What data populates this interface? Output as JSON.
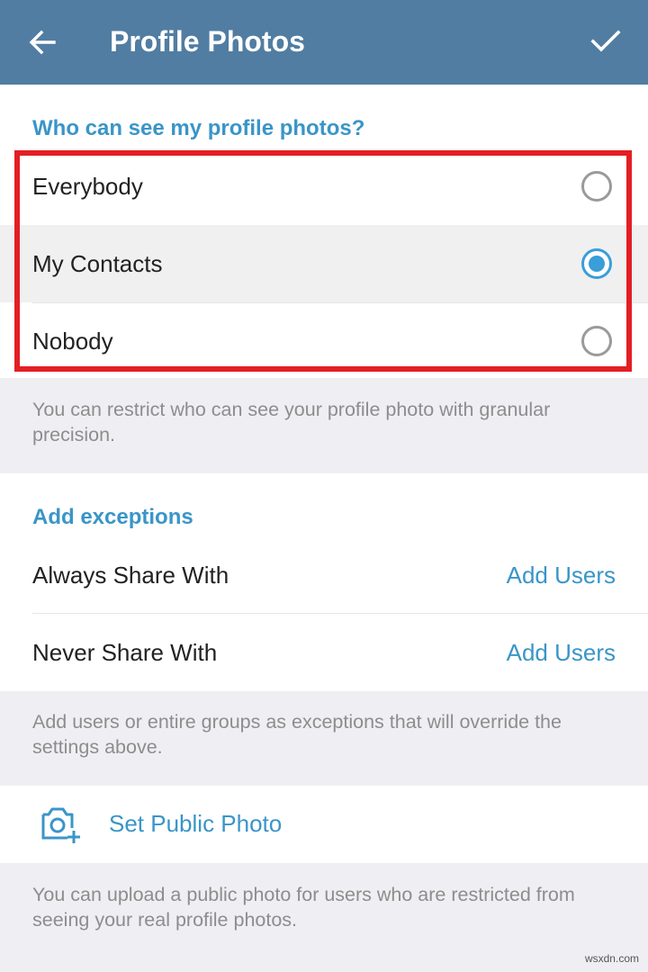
{
  "appbar": {
    "title": "Profile Photos",
    "back_icon": "arrow-left-icon",
    "confirm_icon": "checkmark-icon",
    "color": "#517da2"
  },
  "visibility": {
    "header": "Who can see my profile photos?",
    "options": [
      {
        "label": "Everybody",
        "selected": false
      },
      {
        "label": "My Contacts",
        "selected": true
      },
      {
        "label": "Nobody",
        "selected": false
      }
    ],
    "info": "You can restrict who can see your profile photo with granular precision."
  },
  "exceptions": {
    "header": "Add exceptions",
    "rows": [
      {
        "label": "Always Share With",
        "action": "Add Users"
      },
      {
        "label": "Never Share With",
        "action": "Add Users"
      }
    ],
    "info": "Add users or entire groups as exceptions that will override the settings above."
  },
  "public_photo": {
    "label": "Set Public Photo",
    "icon": "camera-add-icon",
    "info": "You can upload a public photo for users who are restricted from seeing your real profile photos."
  },
  "watermark": "wsxdn.com",
  "colors": {
    "accent": "#3a95c8",
    "radio_checked": "#3a9ed8",
    "highlight": "#e31e24"
  }
}
